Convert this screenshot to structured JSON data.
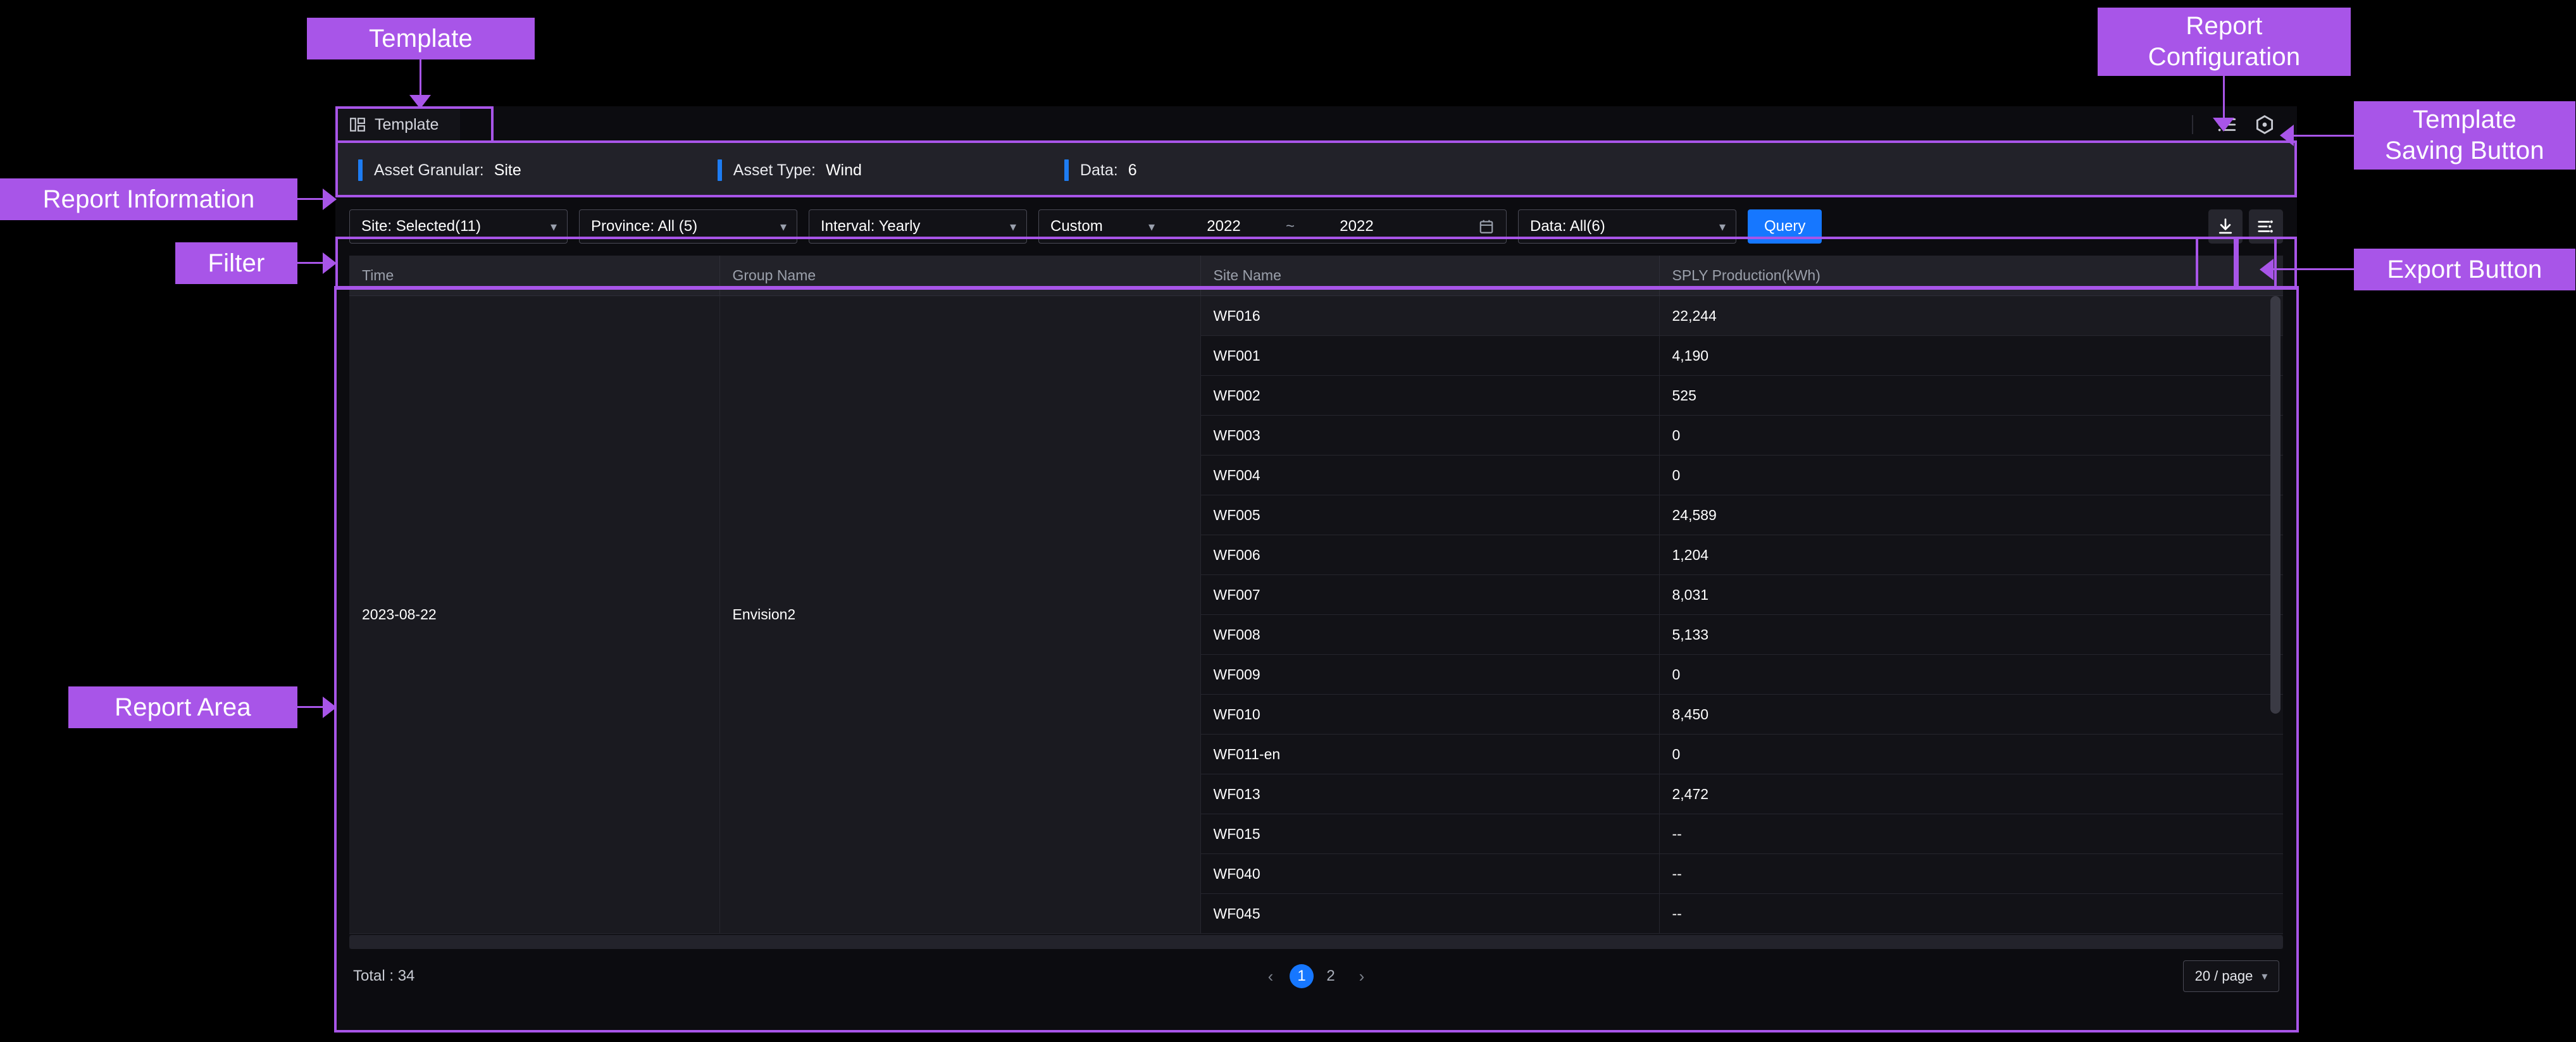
{
  "annotations": [
    {
      "id": "template",
      "label": "Template"
    },
    {
      "id": "report_configuration",
      "label": "Report\nConfiguration"
    },
    {
      "id": "template_saving_button",
      "label": "Template\nSaving Button"
    },
    {
      "id": "report_information",
      "label": "Report Information"
    },
    {
      "id": "filter",
      "label": "Filter"
    },
    {
      "id": "export_button",
      "label": "Export Button"
    },
    {
      "id": "report_area",
      "label": "Report Area"
    }
  ],
  "colors": {
    "annotation_purple": "#a855e8",
    "accent_blue": "#1677ff",
    "info_mark_blue": "#1d7cf2",
    "app_background": "#0c0c10",
    "panel_background": "#222229",
    "table_background": "#121217",
    "row_alt_background": "#1a1a20"
  },
  "tabs": [
    {
      "label": "Template",
      "icon": "layout-template-icon",
      "active": true
    }
  ],
  "header_actions": [
    {
      "name": "report-configuration-button",
      "icon": "list-settings-icon"
    },
    {
      "name": "template-saving-button",
      "icon": "hexagon-gear-icon"
    }
  ],
  "report_information": [
    {
      "label": "Asset Granular:",
      "value": "Site"
    },
    {
      "label": "Asset Type:",
      "value": "Wind"
    },
    {
      "label": "Data:",
      "value": "6"
    }
  ],
  "filter": {
    "site": {
      "label": "Site: Selected(11)"
    },
    "province": {
      "label": "Province: All (5)"
    },
    "interval": {
      "label": "Interval: Yearly"
    },
    "range_mode": {
      "label": "Custom"
    },
    "date_from": "2022",
    "date_separator": "~",
    "date_to": "2022",
    "data": {
      "label": "Data: All(6)"
    },
    "query_button": "Query",
    "export_actions": [
      {
        "name": "download-export-button",
        "icon": "download-icon"
      },
      {
        "name": "export-settings-button",
        "icon": "sliders-icon"
      }
    ]
  },
  "table": {
    "columns": [
      "Time",
      "Group Name",
      "Site Name",
      "SPLY Production(kWh)"
    ],
    "time_value": "2023-08-22",
    "group_value": "Envision2",
    "rows": [
      {
        "site": "WF016",
        "sply": "22,244"
      },
      {
        "site": "WF001",
        "sply": "4,190"
      },
      {
        "site": "WF002",
        "sply": "525"
      },
      {
        "site": "WF003",
        "sply": "0"
      },
      {
        "site": "WF004",
        "sply": "0"
      },
      {
        "site": "WF005",
        "sply": "24,589"
      },
      {
        "site": "WF006",
        "sply": "1,204"
      },
      {
        "site": "WF007",
        "sply": "8,031"
      },
      {
        "site": "WF008",
        "sply": "5,133"
      },
      {
        "site": "WF009",
        "sply": "0"
      },
      {
        "site": "WF010",
        "sply": "8,450"
      },
      {
        "site": "WF011-en",
        "sply": "0"
      },
      {
        "site": "WF013",
        "sply": "2,472"
      },
      {
        "site": "WF015",
        "sply": "--"
      },
      {
        "site": "WF040",
        "sply": "--"
      },
      {
        "site": "WF045",
        "sply": "--"
      }
    ]
  },
  "footer": {
    "total_label": "Total : 34",
    "prev_arrow": "‹",
    "next_arrow": "›",
    "pages": [
      "1",
      "2"
    ],
    "active_page": "1",
    "page_size": "20 / page"
  }
}
